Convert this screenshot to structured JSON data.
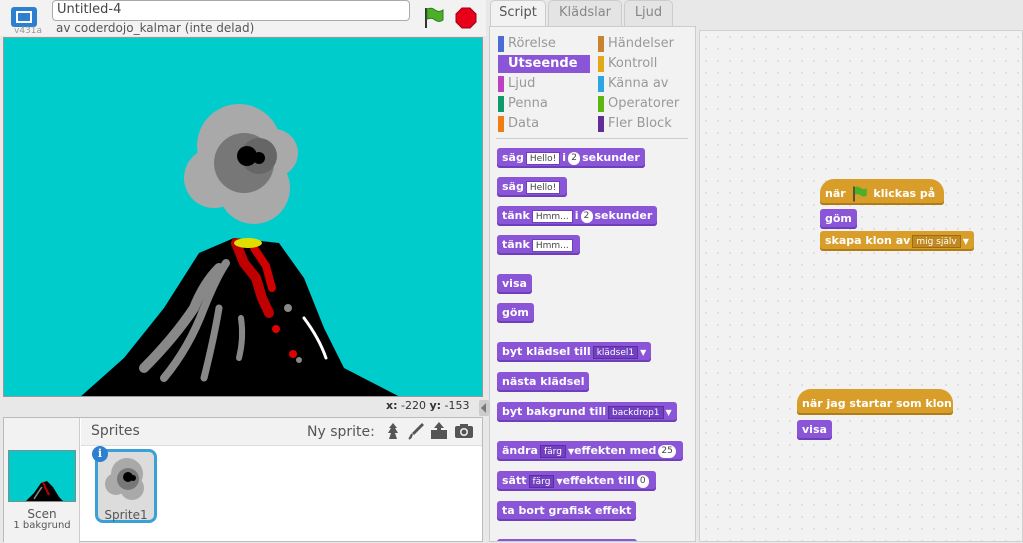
{
  "header": {
    "version": "v431a",
    "project_title": "Untitled-4",
    "owner": "av coderdojo_kalmar (inte delad)"
  },
  "stage": {
    "coords_x_label": "x:",
    "coords_x": "-220",
    "coords_y_label": "y:",
    "coords_y": "-153"
  },
  "sprites_panel": {
    "title": "Sprites",
    "new_sprite_label": "Ny sprite:",
    "scene_label": "Scen",
    "scene_sub": "1 bakgrund",
    "sprite_name": "Sprite1",
    "info_glyph": "i"
  },
  "tabs": [
    "Script",
    "Klädslar",
    "Ljud"
  ],
  "categories": {
    "left": [
      {
        "label": "Rörelse",
        "color": "#4a6cd4"
      },
      {
        "label": "Utseende",
        "color": "#8a55d7"
      },
      {
        "label": "Ljud",
        "color": "#bb42c3"
      },
      {
        "label": "Penna",
        "color": "#0e9a6c"
      },
      {
        "label": "Data",
        "color": "#ee7d16"
      }
    ],
    "right": [
      {
        "label": "Händelser",
        "color": "#c88330"
      },
      {
        "label": "Kontroll",
        "color": "#e1a91a"
      },
      {
        "label": "Känna av",
        "color": "#2ca5e2"
      },
      {
        "label": "Operatorer",
        "color": "#5cb712"
      },
      {
        "label": "Fler Block",
        "color": "#632d99"
      }
    ]
  },
  "palette_blocks": {
    "say_secs": {
      "a": "säg",
      "input": "Hello!",
      "b": "i",
      "num": "2",
      "c": "sekunder"
    },
    "say": {
      "a": "säg",
      "input": "Hello!"
    },
    "think_secs": {
      "a": "tänk",
      "input": "Hmm...",
      "b": "i",
      "num": "2",
      "c": "sekunder"
    },
    "think": {
      "a": "tänk",
      "input": "Hmm..."
    },
    "show": "visa",
    "hide": "göm",
    "switch_costume": {
      "a": "byt klädsel till",
      "dd": "klädsel1"
    },
    "next_costume": "nästa klädsel",
    "switch_backdrop": {
      "a": "byt bakgrund till",
      "dd": "backdrop1"
    },
    "change_effect": {
      "a": "ändra",
      "dd": "färg",
      "b": "effekten med",
      "num": "25"
    },
    "set_effect": {
      "a": "sätt",
      "dd": "färg",
      "b": "effekten till",
      "num": "0"
    },
    "clear_effects": "ta bort grafisk effekt"
  },
  "scripts": {
    "when_flag": {
      "a": "när",
      "b": "klickas på"
    },
    "hide": "göm",
    "create_clone": {
      "a": "skapa klon av",
      "dd": "mig själv"
    },
    "when_clone": "när jag startar som klon",
    "show": "visa"
  }
}
